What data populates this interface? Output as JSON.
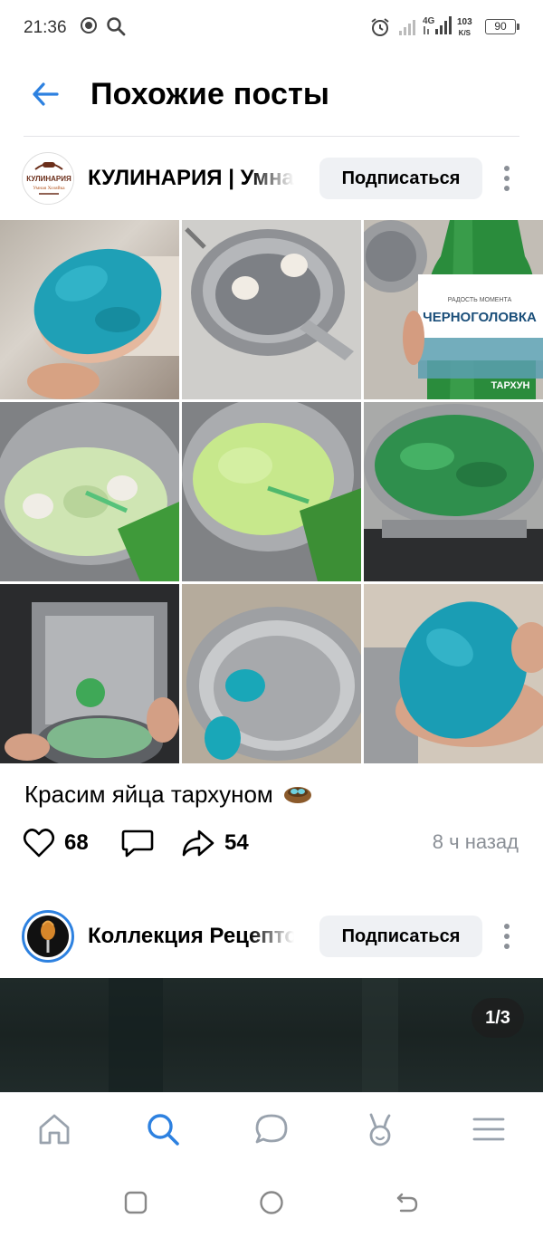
{
  "status_bar": {
    "time": "21:36",
    "network": "4G",
    "speed_value": "103",
    "speed_unit": "K/S",
    "battery": "90",
    "icons": [
      "app-indicator-icon",
      "search-icon",
      "alarm-icon",
      "signal-icon",
      "signal-4g-icon",
      "battery-icon"
    ]
  },
  "header": {
    "title": "Похожие посты",
    "back_icon": "arrow-left-icon"
  },
  "posts": [
    {
      "author": "КУЛИНАРИЯ | Умная Хозяйка",
      "avatar_text": [
        "КУЛИНАРИЯ",
        "Умная Хозяйка"
      ],
      "subscribe_label": "Подписаться",
      "photos": [
        "blue-egg-in-hand",
        "eggs-in-pot",
        "tarragon-soda-bottle",
        "pouring-soda-into-pot",
        "pouring-soda-foam",
        "boiling-green-water",
        "draining-pot-in-sink",
        "blue-eggs-in-pot",
        "blue-egg-closeup"
      ],
      "bottle_brand": "ЧЕРНОГОЛОВКА",
      "bottle_small": "РАДОСТЬ МОМЕНТА",
      "bottle_flavor": "ТАРХУН",
      "caption": "Красим яйца тархуном",
      "likes": "68",
      "shares": "54",
      "time_ago": "8 ч назад"
    },
    {
      "author": "Коллекция Рецептов",
      "subscribe_label": "Подписаться",
      "photo_counter": "1/3"
    }
  ],
  "bottom_nav": {
    "items": [
      "home-icon",
      "search-icon",
      "messages-icon",
      "clips-icon",
      "menu-icon"
    ],
    "active": "search-icon"
  },
  "system_nav": [
    "recent-apps-icon",
    "home-circle-icon",
    "back-icon"
  ],
  "colors": {
    "accent": "#2d81e0",
    "text_secondary": "#8a8f96",
    "button_bg": "#eff1f4"
  }
}
